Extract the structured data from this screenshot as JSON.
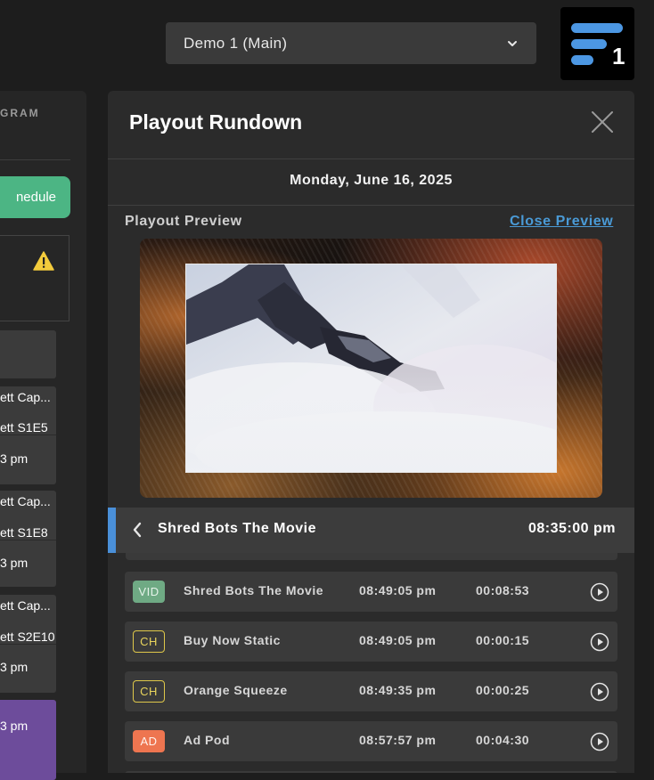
{
  "channel_select": {
    "value": "Demo 1 (Main)",
    "icon": "chevron-down-icon"
  },
  "logo": {
    "number": "1",
    "colors": {
      "bars": "#4c97e3",
      "background": "#000000"
    }
  },
  "left_panel": {
    "program_label": "GRAM",
    "schedule_button": "nedule",
    "warning_icon": "warning-icon",
    "cards": [
      {
        "title": "ett Cap...",
        "episode": "ett S1E5",
        "time": "3 pm"
      },
      {
        "title": "ett Cap...",
        "episode": "ett S1E8",
        "time": "3 pm"
      },
      {
        "title": "ett Cap...",
        "episode": "ett S2E10",
        "time": "3 pm"
      },
      {
        "time": "3 pm"
      }
    ]
  },
  "rundown": {
    "title": "Playout Rundown",
    "date": "Monday, June 16, 2025",
    "preview_label": "Playout Preview",
    "close_preview": "Close Preview",
    "now_playing": {
      "title": "Shred Bots The Movie",
      "time": "08:35:00 pm"
    },
    "rows": [
      {
        "badge": "VID",
        "name": "Shred Bots The Movie",
        "start": "08:49:05 pm",
        "duration": "00:08:53"
      },
      {
        "badge": "CH",
        "name": "Buy Now Static",
        "start": "08:49:05 pm",
        "duration": "00:00:15"
      },
      {
        "badge": "CH",
        "name": "Orange Squeeze",
        "start": "08:49:35 pm",
        "duration": "00:00:25"
      },
      {
        "badge": "AD",
        "name": "Ad Pod",
        "start": "08:57:57 pm",
        "duration": "00:04:30"
      }
    ]
  },
  "colors": {
    "accent_blue": "#4a90d9",
    "schedule_green": "#4cb584",
    "vid_badge": "#6faa84",
    "ch_badge": "#dfc84a",
    "ad_badge": "#ee7550",
    "purple_card": "#6d4c9b",
    "link": "#4a9ad6"
  }
}
